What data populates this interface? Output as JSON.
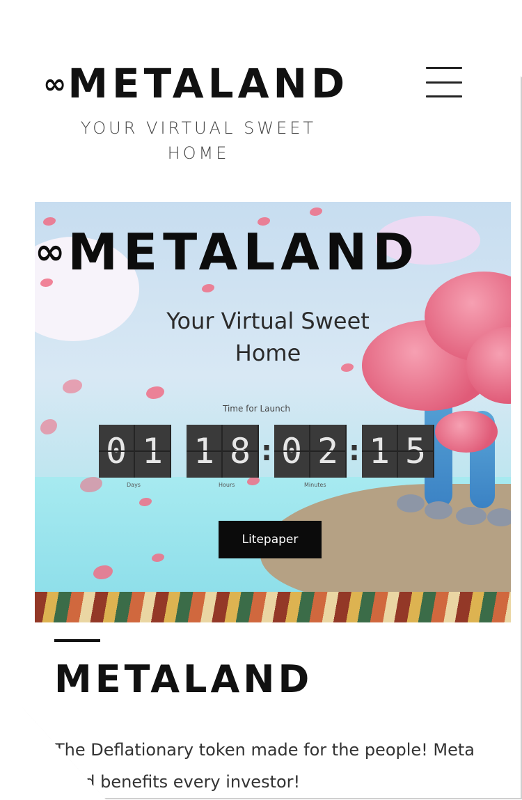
{
  "header": {
    "logo_symbol": "∞",
    "logo_text": "METALAND",
    "tagline": "YOUR VIRTUAL SWEET HOME"
  },
  "hero": {
    "title_symbol": "∞",
    "title": "METALAND",
    "subtitle": "Your Virtual Sweet Home",
    "countdown_label": "Time for Launch",
    "countdown": {
      "days": [
        "0",
        "1"
      ],
      "hours": [
        "1",
        "8"
      ],
      "minutes": [
        "0",
        "2"
      ],
      "seconds": [
        "1",
        "5"
      ],
      "separator": ":"
    },
    "unit_labels": {
      "days": "Days",
      "hours": "Hours",
      "minutes": "Minutes"
    },
    "cta_label": "Litepaper"
  },
  "section": {
    "title": "METALAND",
    "body": "The Deflationary token made for the people! Meta Land benefits every investor!"
  },
  "colors": {
    "text_dark": "#111111",
    "button_bg": "#0b0b0b",
    "button_text": "#ffffff",
    "digit_bg": "#3a3a3a",
    "petal": "#ef6f86"
  },
  "icons": {
    "menu": "hamburger-menu-icon",
    "logo": "infinity-icon"
  }
}
